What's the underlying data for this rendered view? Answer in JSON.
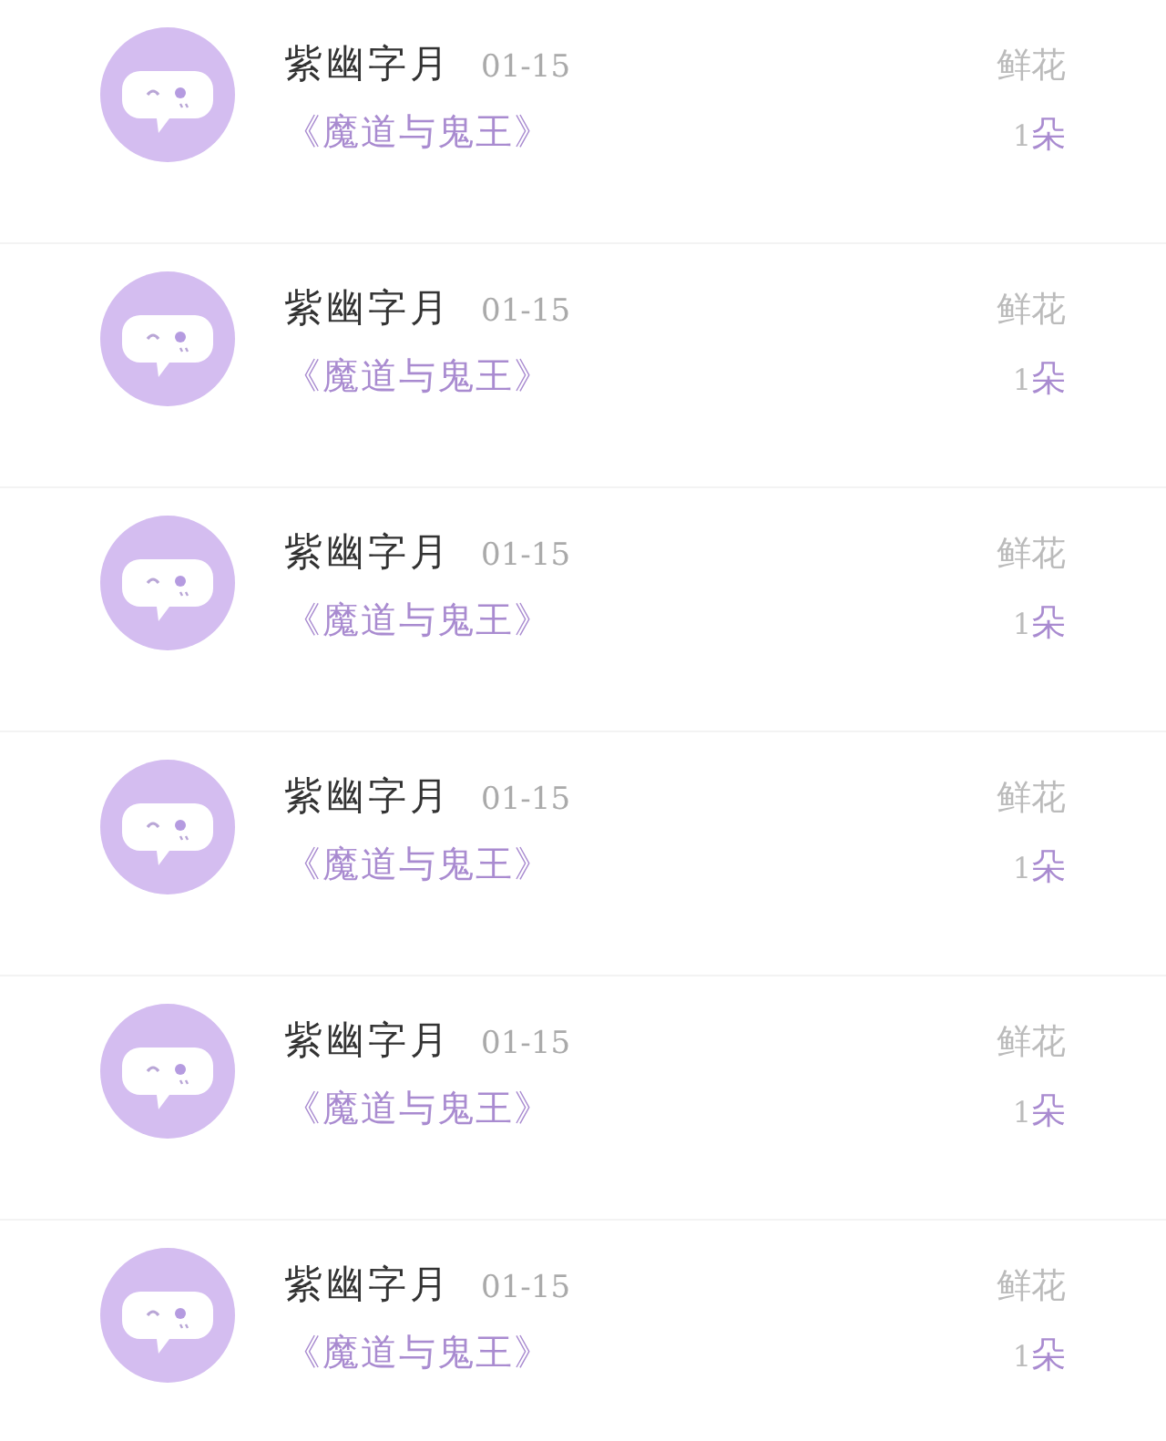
{
  "gifts": [
    {
      "name": "紫幽字月",
      "date": "01-15",
      "book": "《魔道与鬼王》",
      "gift": "鲜花",
      "count": "1",
      "unit": "朵"
    },
    {
      "name": "紫幽字月",
      "date": "01-15",
      "book": "《魔道与鬼王》",
      "gift": "鲜花",
      "count": "1",
      "unit": "朵"
    },
    {
      "name": "紫幽字月",
      "date": "01-15",
      "book": "《魔道与鬼王》",
      "gift": "鲜花",
      "count": "1",
      "unit": "朵"
    },
    {
      "name": "紫幽字月",
      "date": "01-15",
      "book": "《魔道与鬼王》",
      "gift": "鲜花",
      "count": "1",
      "unit": "朵"
    },
    {
      "name": "紫幽字月",
      "date": "01-15",
      "book": "《魔道与鬼王》",
      "gift": "鲜花",
      "count": "1",
      "unit": "朵"
    },
    {
      "name": "紫幽字月",
      "date": "01-15",
      "book": "《魔道与鬼王》",
      "gift": "鲜花",
      "count": "1",
      "unit": "朵"
    }
  ]
}
